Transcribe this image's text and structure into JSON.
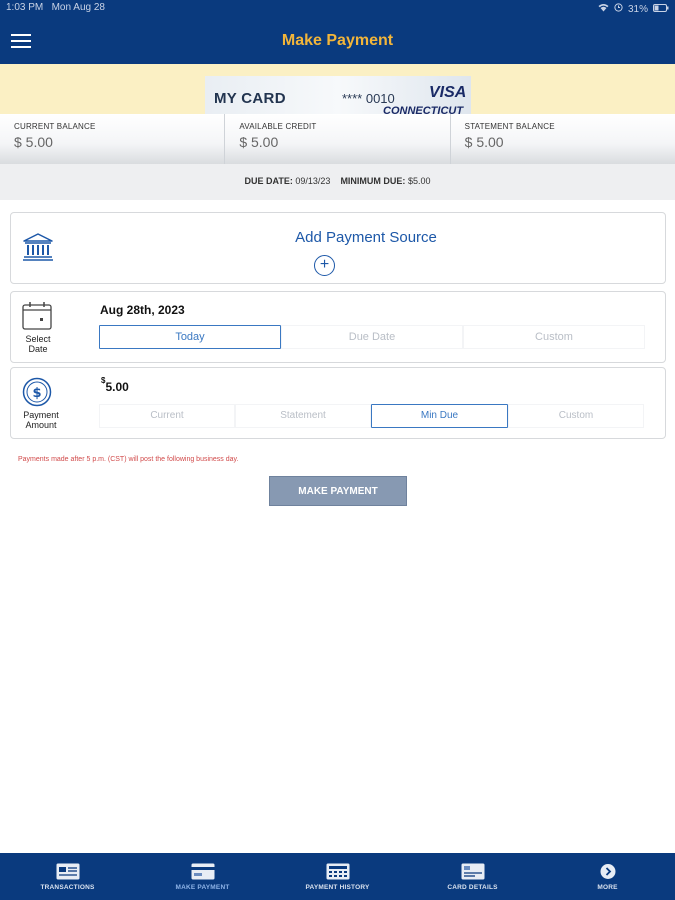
{
  "status_bar": {
    "time": "1:03 PM",
    "date": "Mon Aug 28",
    "battery": "31%"
  },
  "header": {
    "title": "Make Payment",
    "menu_icon": "hamburger-menu-icon"
  },
  "card": {
    "label": "MY CARD",
    "digits": "**** 0010",
    "brand": "VISA",
    "sub": "CONNECTICUT"
  },
  "balances": [
    {
      "label": "CURRENT BALANCE",
      "value": "$ 5.00"
    },
    {
      "label": "AVAILABLE CREDIT",
      "value": "$ 5.00"
    },
    {
      "label": "STATEMENT BALANCE",
      "value": "$ 5.00"
    }
  ],
  "due": {
    "due_date_label": "DUE DATE:",
    "due_date": "09/13/23",
    "min_due_label": "MINIMUM DUE:",
    "min_due": "$5.00"
  },
  "payment_source": {
    "label": "Add Payment Source",
    "plus": "+",
    "icon": "bank-icon"
  },
  "select_date": {
    "label": "Select Date",
    "value": "Aug 28th, 2023",
    "options": [
      "Today",
      "Due Date",
      "Custom"
    ],
    "selected": "Today"
  },
  "payment_amount": {
    "label_line1": "Payment",
    "label_line2": "Amount",
    "currency": "$",
    "value": "5.00",
    "options": [
      "Current",
      "Statement",
      "Min Due",
      "Custom"
    ],
    "selected": "Min Due"
  },
  "note": "Payments made after 5 p.m. (CST) will post the following business day.",
  "submit": "MAKE PAYMENT",
  "nav": [
    {
      "label": "TRANSACTIONS",
      "icon": "card-list-icon"
    },
    {
      "label": "MAKE PAYMENT",
      "icon": "card-icon",
      "active": true
    },
    {
      "label": "PAYMENT HISTORY",
      "icon": "calculator-icon"
    },
    {
      "label": "CARD DETAILS",
      "icon": "card-details-icon"
    },
    {
      "label": "MORE",
      "icon": "chevron-right-circle-icon"
    }
  ],
  "colors": {
    "primary": "#0a3a7e",
    "accent": "#f2b53a",
    "link": "#1d58a8",
    "warning": "#d14a4a"
  }
}
